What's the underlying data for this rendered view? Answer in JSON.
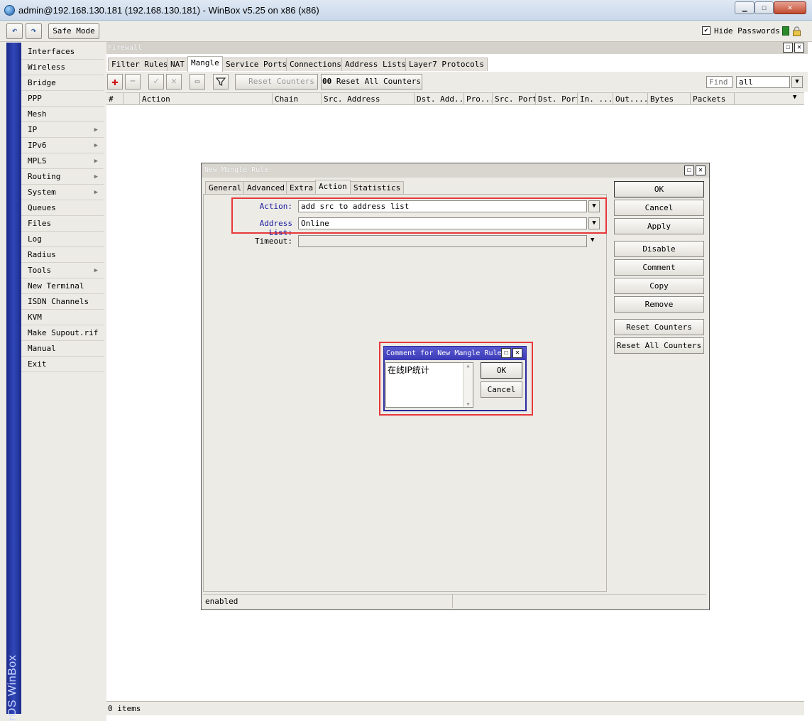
{
  "window": {
    "title": "admin@192.168.130.181 (192.168.130.181) - WinBox v5.25 on x86 (x86)"
  },
  "toolbar": {
    "undo": "↶",
    "redo": "↷",
    "safe_mode": "Safe Mode",
    "hide_passwords": "Hide Passwords"
  },
  "brand": "RouterOS WinBox",
  "menu": [
    {
      "label": "Interfaces",
      "sub": false
    },
    {
      "label": "Wireless",
      "sub": false
    },
    {
      "label": "Bridge",
      "sub": false
    },
    {
      "label": "PPP",
      "sub": false
    },
    {
      "label": "Mesh",
      "sub": false
    },
    {
      "label": "IP",
      "sub": true
    },
    {
      "label": "IPv6",
      "sub": true
    },
    {
      "label": "MPLS",
      "sub": true
    },
    {
      "label": "Routing",
      "sub": true
    },
    {
      "label": "System",
      "sub": true
    },
    {
      "label": "Queues",
      "sub": false
    },
    {
      "label": "Files",
      "sub": false
    },
    {
      "label": "Log",
      "sub": false
    },
    {
      "label": "Radius",
      "sub": false
    },
    {
      "label": "Tools",
      "sub": true
    },
    {
      "label": "New Terminal",
      "sub": false
    },
    {
      "label": "ISDN Channels",
      "sub": false
    },
    {
      "label": "KVM",
      "sub": false
    },
    {
      "label": "Make Supout.rif",
      "sub": false
    },
    {
      "label": "Manual",
      "sub": false
    },
    {
      "label": "Exit",
      "sub": false
    }
  ],
  "firewall": {
    "title": "Firewall",
    "tabs": [
      "Filter Rules",
      "NAT",
      "Mangle",
      "Service Ports",
      "Connections",
      "Address Lists",
      "Layer7 Protocols"
    ],
    "active_tab": "Mangle",
    "reset_counters": "Reset Counters",
    "reset_all_counters": "Reset All Counters",
    "reset_all_prefix": "00",
    "find_placeholder": "Find",
    "filter_value": "all",
    "columns": [
      "#",
      "",
      "Action",
      "Chain",
      "Src. Address",
      "Dst. Add...",
      "Pro...",
      "Src. Port",
      "Dst. Port",
      "In. ...",
      "Out....",
      "Bytes",
      "Packets"
    ],
    "status": "0 items"
  },
  "dialog": {
    "title": "New Mangle Rule",
    "tabs": [
      "General",
      "Advanced",
      "Extra",
      "Action",
      "Statistics"
    ],
    "active_tab": "Action",
    "fields": {
      "action_label": "Action:",
      "action_value": "add src to address list",
      "address_list_label": "Address List:",
      "address_list_value": "Online",
      "timeout_label": "Timeout:",
      "timeout_value": ""
    },
    "buttons": [
      "OK",
      "Cancel",
      "Apply",
      "Disable",
      "Comment",
      "Copy",
      "Remove",
      "Reset Counters",
      "Reset All Counters"
    ],
    "status": "enabled"
  },
  "comment_dialog": {
    "title": "Comment for New Mangle Rule",
    "text": "在线IP统计",
    "ok": "OK",
    "cancel": "Cancel"
  },
  "colors": {
    "highlight": "#e8383a",
    "label_blue": "#1a1aa0",
    "brand_bar": "#2a3aa8"
  }
}
